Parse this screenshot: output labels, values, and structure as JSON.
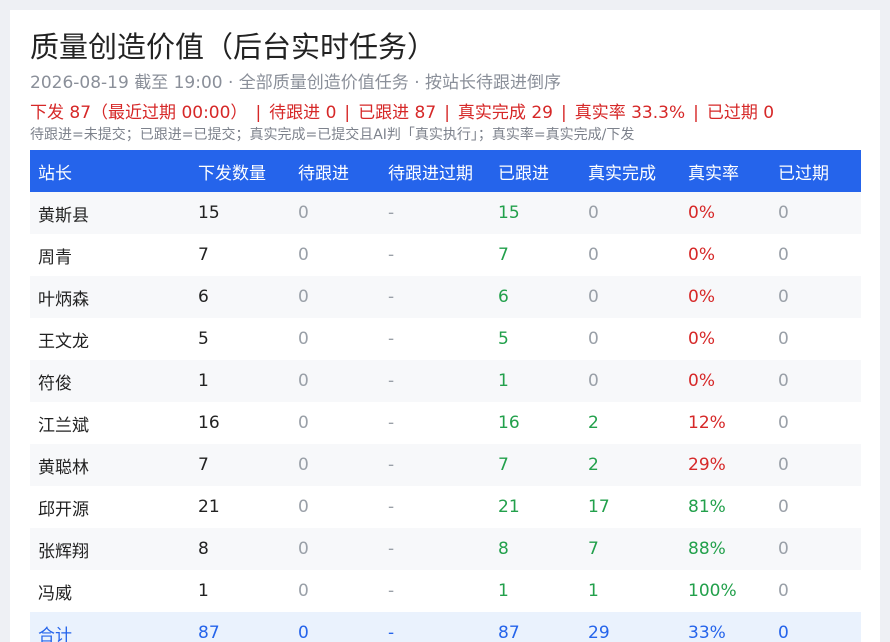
{
  "header": {
    "title": "质量创造价值（后台实时任务）",
    "subtitle": "2026-08-19 截至 19:00 · 全部质量创造价值任务 · 按站长待跟进倒序",
    "summary": [
      "下发 87（最近过期 00:00）",
      "待跟进 0",
      "已跟进 87",
      "真实完成 29",
      "真实率 33.3%",
      "已过期 0"
    ],
    "summary_separator": "|",
    "note": "待跟进=未提交；已跟进=已提交；真实完成=已提交且AI判「真实执行」；真实率=真实完成/下发"
  },
  "colors": {
    "header_bg": "#2564eb",
    "red": "#d62828",
    "green": "#22a04b",
    "gray": "#9aa0a8",
    "total_bg": "#eaf2fd"
  },
  "table": {
    "columns": [
      "站长",
      "下发数量",
      "待跟进",
      "待跟进过期",
      "已跟进",
      "真实完成",
      "真实率",
      "已过期"
    ],
    "rows": [
      {
        "name": "黄斯县",
        "issued": "15",
        "pending": "0",
        "pending_expired": "-",
        "followed": "15",
        "real_done": "0",
        "real_rate": "0%",
        "expired": "0",
        "rate_level": "red",
        "done_level": "gray"
      },
      {
        "name": "周青",
        "issued": "7",
        "pending": "0",
        "pending_expired": "-",
        "followed": "7",
        "real_done": "0",
        "real_rate": "0%",
        "expired": "0",
        "rate_level": "red",
        "done_level": "gray"
      },
      {
        "name": "叶炳森",
        "issued": "6",
        "pending": "0",
        "pending_expired": "-",
        "followed": "6",
        "real_done": "0",
        "real_rate": "0%",
        "expired": "0",
        "rate_level": "red",
        "done_level": "gray"
      },
      {
        "name": "王文龙",
        "issued": "5",
        "pending": "0",
        "pending_expired": "-",
        "followed": "5",
        "real_done": "0",
        "real_rate": "0%",
        "expired": "0",
        "rate_level": "red",
        "done_level": "gray"
      },
      {
        "name": "符俊",
        "issued": "1",
        "pending": "0",
        "pending_expired": "-",
        "followed": "1",
        "real_done": "0",
        "real_rate": "0%",
        "expired": "0",
        "rate_level": "red",
        "done_level": "gray"
      },
      {
        "name": "江兰斌",
        "issued": "16",
        "pending": "0",
        "pending_expired": "-",
        "followed": "16",
        "real_done": "2",
        "real_rate": "12%",
        "expired": "0",
        "rate_level": "red",
        "done_level": "green"
      },
      {
        "name": "黄聪林",
        "issued": "7",
        "pending": "0",
        "pending_expired": "-",
        "followed": "7",
        "real_done": "2",
        "real_rate": "29%",
        "expired": "0",
        "rate_level": "red",
        "done_level": "green"
      },
      {
        "name": "邱开源",
        "issued": "21",
        "pending": "0",
        "pending_expired": "-",
        "followed": "21",
        "real_done": "17",
        "real_rate": "81%",
        "expired": "0",
        "rate_level": "green",
        "done_level": "green"
      },
      {
        "name": "张辉翔",
        "issued": "8",
        "pending": "0",
        "pending_expired": "-",
        "followed": "8",
        "real_done": "7",
        "real_rate": "88%",
        "expired": "0",
        "rate_level": "green",
        "done_level": "green"
      },
      {
        "name": "冯威",
        "issued": "1",
        "pending": "0",
        "pending_expired": "-",
        "followed": "1",
        "real_done": "1",
        "real_rate": "100%",
        "expired": "0",
        "rate_level": "green",
        "done_level": "green"
      }
    ],
    "total": {
      "name": "合计",
      "issued": "87",
      "pending": "0",
      "pending_expired": "-",
      "followed": "87",
      "real_done": "29",
      "real_rate": "33%",
      "expired": "0"
    }
  }
}
